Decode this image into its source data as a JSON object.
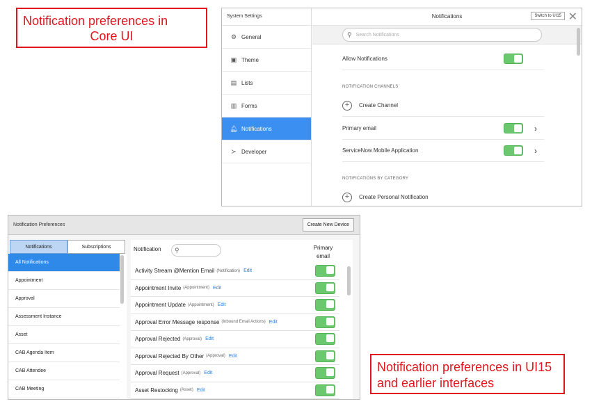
{
  "callouts": {
    "top_line1": "Notification preferences in",
    "top_line2": "Core UI",
    "bottom": "Notification preferences in UI15 and earlier interfaces"
  },
  "core_ui": {
    "sidebar_title": "System Settings",
    "nav": [
      {
        "label": "General",
        "icon": "gear-icon"
      },
      {
        "label": "Theme",
        "icon": "image-icon"
      },
      {
        "label": "Lists",
        "icon": "list-icon"
      },
      {
        "label": "Forms",
        "icon": "form-icon"
      },
      {
        "label": "Notifications",
        "icon": "bell-icon",
        "active": true
      },
      {
        "label": "Developer",
        "icon": "developer-icon"
      }
    ],
    "title": "Notifications",
    "switch_label": "Switch to UI15",
    "search_placeholder": "Search Notifications",
    "allow_label": "Allow Notifications",
    "allow_on": true,
    "channels_header": "NOTIFICATION CHANNELS",
    "create_channel": "Create Channel",
    "channels": [
      {
        "label": "Primary email",
        "on": true
      },
      {
        "label": "ServiceNow Mobile Application",
        "on": true
      }
    ],
    "category_header": "NOTIFICATIONS BY CATEGORY",
    "create_personal": "Create Personal Notification",
    "accent_color": "#3b8ff0",
    "toggle_color": "#6cc86e"
  },
  "ui15": {
    "title": "Notification Preferences",
    "new_device": "Create New Device",
    "tabs": [
      "Notifications",
      "Subscriptions"
    ],
    "categories": [
      "All Notifications",
      "Appointment",
      "Approval",
      "Assessment Instance",
      "Asset",
      "CAB Agenda Item",
      "CAB Attendee",
      "CAB Meeting"
    ],
    "notification_label": "Notification",
    "column_header": "Primary email",
    "edit_label": "Edit",
    "rows": [
      {
        "name": "Activity Stream @Mention Email",
        "kind": "(Notification)",
        "on": true
      },
      {
        "name": "Appointment Invite",
        "kind": "(Appointment)",
        "on": true
      },
      {
        "name": "Appointment Update",
        "kind": "(Appointment)",
        "on": true
      },
      {
        "name": "Approval Error Message response",
        "kind": "(Inbound Email Actions)",
        "on": true
      },
      {
        "name": "Approval Rejected",
        "kind": "(Approval)",
        "on": true
      },
      {
        "name": "Approval Rejected By Other",
        "kind": "(Approval)",
        "on": true
      },
      {
        "name": "Approval Request",
        "kind": "(Approval)",
        "on": true
      },
      {
        "name": "Asset Restocking",
        "kind": "(Asset)",
        "on": true
      }
    ]
  }
}
